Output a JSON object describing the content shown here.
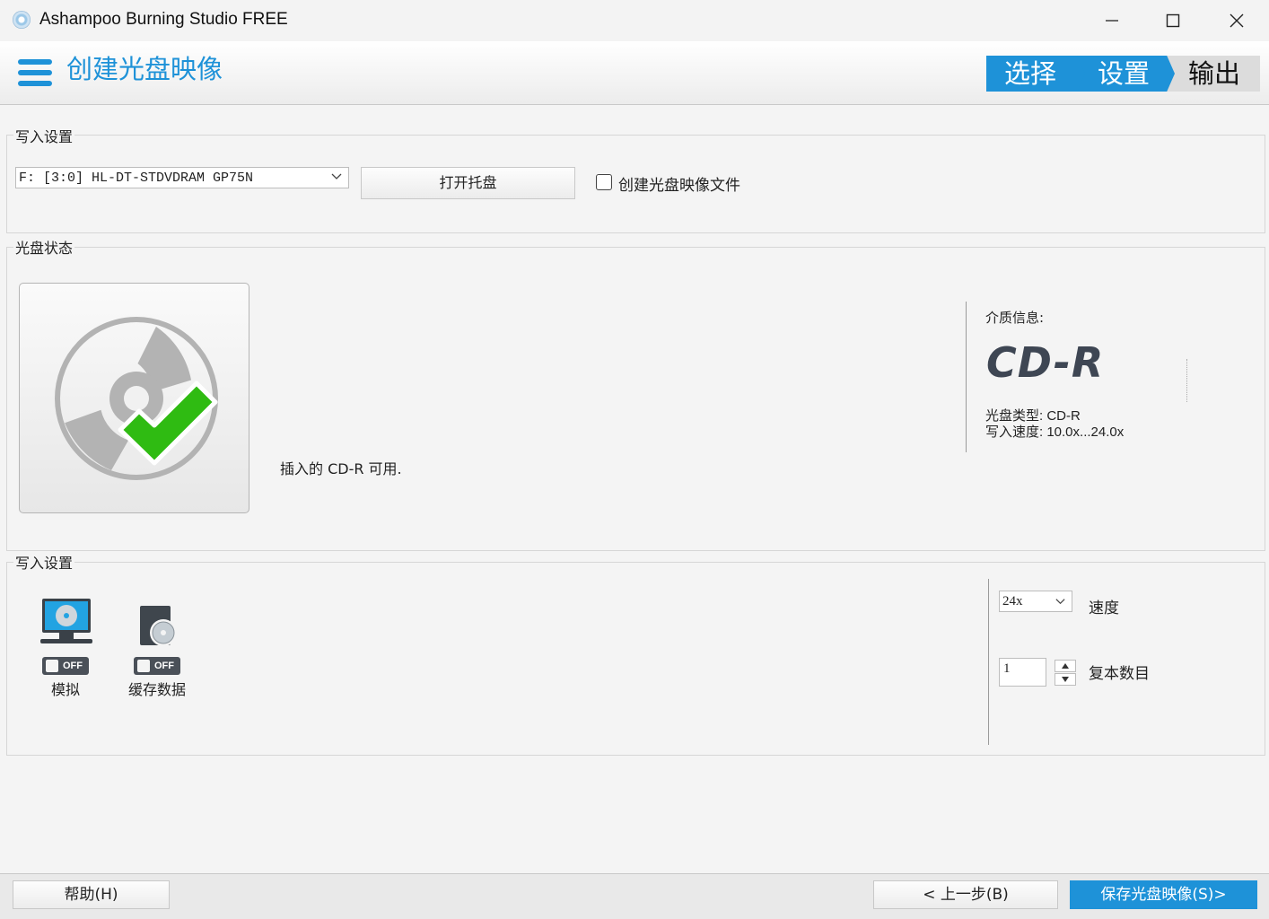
{
  "window": {
    "title": "Ashampoo Burning Studio FREE"
  },
  "header": {
    "page_title": "创建光盘映像",
    "steps": [
      "选择",
      "设置",
      "输出"
    ],
    "accent_color": "#1e92d8"
  },
  "write_settings_top": {
    "legend": "写入设置",
    "drive": "F: [3:0] HL-DT-STDVDRAM GP75N",
    "open_tray_label": "打开托盘",
    "create_image_checkbox_label": "创建光盘映像文件",
    "create_image_checked": false
  },
  "disc_status": {
    "legend": "光盘状态",
    "message": "插入的 CD-R 可用.",
    "media_info_label": "介质信息:",
    "media_big": "CD-R",
    "disc_type": "光盘类型: CD-R",
    "write_speed": "写入速度: 10.0x...24.0x"
  },
  "write_settings_bottom": {
    "legend": "写入设置",
    "options": [
      {
        "label": "模拟",
        "toggle": "OFF",
        "icon": "monitor-disc-icon"
      },
      {
        "label": "缓存数据",
        "toggle": "OFF",
        "icon": "drive-disc-icon"
      }
    ],
    "speed_value": "24x",
    "speed_label": "速度",
    "copies_value": "1",
    "copies_label": "复本数目"
  },
  "footer": {
    "help_label": "帮助(H)",
    "back_label": "< 上一步(B)",
    "save_label": "保存光盘映像(S)>"
  }
}
